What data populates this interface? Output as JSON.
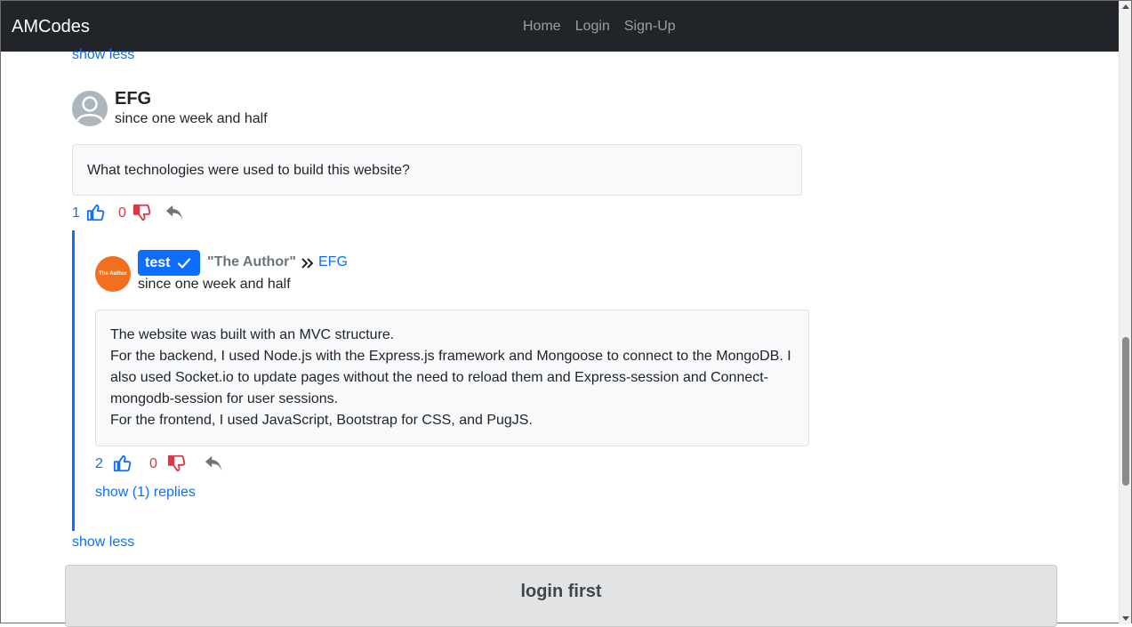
{
  "nav": {
    "brand": "AMCodes",
    "links": [
      "Home",
      "Login",
      "Sign-Up"
    ]
  },
  "thread": {
    "show_less_top": "show less",
    "comment": {
      "author": "EFG",
      "since": "since one week and half",
      "text": "What technologies were used to build this website?",
      "likes": "1",
      "dislikes": "0"
    },
    "reply": {
      "avatar_text": "The Author",
      "badge": "test",
      "author_tag": "\"The Author\"",
      "reply_to": "EFG",
      "since": "since one week and half",
      "lines": [
        "The website was built with an MVC structure.",
        "For the backend, I used Node.js with the Express.js framework and Mongoose to connect to the MongoDB. I",
        "also used Socket.io to update pages without the need to reload them and Express-session and Connect-",
        "mongodb-session for user sessions.",
        "For the frontend, I used JavaScript, Bootstrap for CSS, and PugJS."
      ],
      "likes": "2",
      "dislikes": "0",
      "show_replies": "show (1) replies"
    },
    "show_less_bottom": "show less",
    "login_prompt": "login first"
  },
  "colors": {
    "navbar": "#212529",
    "link": "#0d6efd",
    "dislike": "#dc3545",
    "author_avatar": "#f26f1f"
  }
}
